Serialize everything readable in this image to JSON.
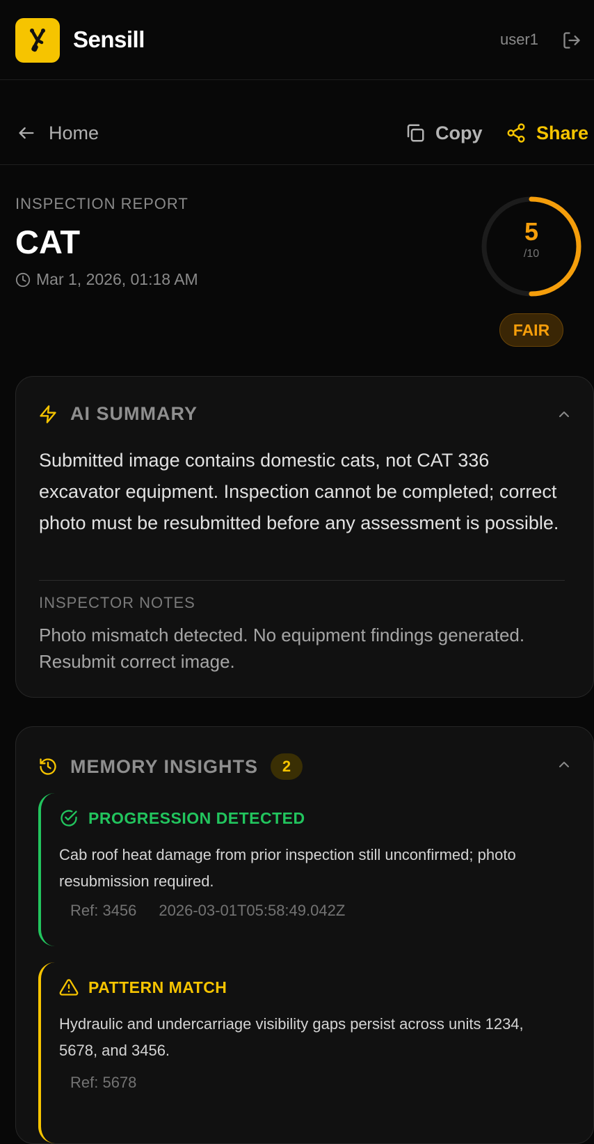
{
  "app": {
    "brand": "Sensill",
    "user": "user1",
    "accent_color": "#f6c400"
  },
  "nav": {
    "home_label": "Home",
    "copy_label": "Copy",
    "share_label": "Share"
  },
  "report": {
    "kicker": "INSPECTION REPORT",
    "title": "CAT",
    "date": "Mar 1, 2026, 01:18 AM",
    "score": "5",
    "score_max": "/10",
    "score_fraction": 0.5,
    "rating": "FAIR",
    "rating_color": "#f59e0b"
  },
  "summary": {
    "title": "AI SUMMARY",
    "text": "Submitted image contains domestic cats, not CAT 336 excavator equipment. Inspection cannot be completed; correct photo must be resubmitted before any assessment is possible.",
    "notes_label": "INSPECTOR NOTES",
    "notes_text": "Photo mismatch detected. No equipment findings generated. Resubmit correct image."
  },
  "memory": {
    "title": "MEMORY INSIGHTS",
    "count": "2",
    "insights": [
      {
        "title": "PROGRESSION DETECTED",
        "color": "#22c55e",
        "icon": "check-circle-icon",
        "text": "Cab roof heat damage from prior inspection still unconfirmed; photo resubmission required.",
        "ref": "Ref: 3456",
        "timestamp": "2026-03-01T05:58:49.042Z"
      },
      {
        "title": "PATTERN MATCH",
        "color": "#f6c400",
        "icon": "warning-triangle-icon",
        "text": "Hydraulic and undercarriage visibility gaps persist across units 1234, 5678, and 3456.",
        "ref": "Ref: 5678"
      }
    ]
  }
}
